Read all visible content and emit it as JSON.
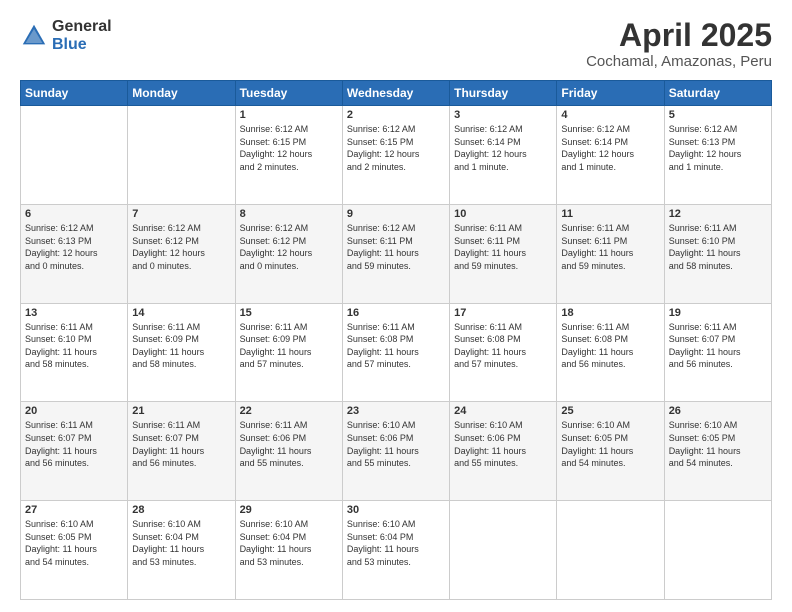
{
  "logo": {
    "general": "General",
    "blue": "Blue"
  },
  "header": {
    "title": "April 2025",
    "subtitle": "Cochamal, Amazonas, Peru"
  },
  "days_of_week": [
    "Sunday",
    "Monday",
    "Tuesday",
    "Wednesday",
    "Thursday",
    "Friday",
    "Saturday"
  ],
  "weeks": [
    [
      {
        "day": "",
        "info": ""
      },
      {
        "day": "",
        "info": ""
      },
      {
        "day": "1",
        "info": "Sunrise: 6:12 AM\nSunset: 6:15 PM\nDaylight: 12 hours\nand 2 minutes."
      },
      {
        "day": "2",
        "info": "Sunrise: 6:12 AM\nSunset: 6:15 PM\nDaylight: 12 hours\nand 2 minutes."
      },
      {
        "day": "3",
        "info": "Sunrise: 6:12 AM\nSunset: 6:14 PM\nDaylight: 12 hours\nand 1 minute."
      },
      {
        "day": "4",
        "info": "Sunrise: 6:12 AM\nSunset: 6:14 PM\nDaylight: 12 hours\nand 1 minute."
      },
      {
        "day": "5",
        "info": "Sunrise: 6:12 AM\nSunset: 6:13 PM\nDaylight: 12 hours\nand 1 minute."
      }
    ],
    [
      {
        "day": "6",
        "info": "Sunrise: 6:12 AM\nSunset: 6:13 PM\nDaylight: 12 hours\nand 0 minutes."
      },
      {
        "day": "7",
        "info": "Sunrise: 6:12 AM\nSunset: 6:12 PM\nDaylight: 12 hours\nand 0 minutes."
      },
      {
        "day": "8",
        "info": "Sunrise: 6:12 AM\nSunset: 6:12 PM\nDaylight: 12 hours\nand 0 minutes."
      },
      {
        "day": "9",
        "info": "Sunrise: 6:12 AM\nSunset: 6:11 PM\nDaylight: 11 hours\nand 59 minutes."
      },
      {
        "day": "10",
        "info": "Sunrise: 6:11 AM\nSunset: 6:11 PM\nDaylight: 11 hours\nand 59 minutes."
      },
      {
        "day": "11",
        "info": "Sunrise: 6:11 AM\nSunset: 6:11 PM\nDaylight: 11 hours\nand 59 minutes."
      },
      {
        "day": "12",
        "info": "Sunrise: 6:11 AM\nSunset: 6:10 PM\nDaylight: 11 hours\nand 58 minutes."
      }
    ],
    [
      {
        "day": "13",
        "info": "Sunrise: 6:11 AM\nSunset: 6:10 PM\nDaylight: 11 hours\nand 58 minutes."
      },
      {
        "day": "14",
        "info": "Sunrise: 6:11 AM\nSunset: 6:09 PM\nDaylight: 11 hours\nand 58 minutes."
      },
      {
        "day": "15",
        "info": "Sunrise: 6:11 AM\nSunset: 6:09 PM\nDaylight: 11 hours\nand 57 minutes."
      },
      {
        "day": "16",
        "info": "Sunrise: 6:11 AM\nSunset: 6:08 PM\nDaylight: 11 hours\nand 57 minutes."
      },
      {
        "day": "17",
        "info": "Sunrise: 6:11 AM\nSunset: 6:08 PM\nDaylight: 11 hours\nand 57 minutes."
      },
      {
        "day": "18",
        "info": "Sunrise: 6:11 AM\nSunset: 6:08 PM\nDaylight: 11 hours\nand 56 minutes."
      },
      {
        "day": "19",
        "info": "Sunrise: 6:11 AM\nSunset: 6:07 PM\nDaylight: 11 hours\nand 56 minutes."
      }
    ],
    [
      {
        "day": "20",
        "info": "Sunrise: 6:11 AM\nSunset: 6:07 PM\nDaylight: 11 hours\nand 56 minutes."
      },
      {
        "day": "21",
        "info": "Sunrise: 6:11 AM\nSunset: 6:07 PM\nDaylight: 11 hours\nand 56 minutes."
      },
      {
        "day": "22",
        "info": "Sunrise: 6:11 AM\nSunset: 6:06 PM\nDaylight: 11 hours\nand 55 minutes."
      },
      {
        "day": "23",
        "info": "Sunrise: 6:10 AM\nSunset: 6:06 PM\nDaylight: 11 hours\nand 55 minutes."
      },
      {
        "day": "24",
        "info": "Sunrise: 6:10 AM\nSunset: 6:06 PM\nDaylight: 11 hours\nand 55 minutes."
      },
      {
        "day": "25",
        "info": "Sunrise: 6:10 AM\nSunset: 6:05 PM\nDaylight: 11 hours\nand 54 minutes."
      },
      {
        "day": "26",
        "info": "Sunrise: 6:10 AM\nSunset: 6:05 PM\nDaylight: 11 hours\nand 54 minutes."
      }
    ],
    [
      {
        "day": "27",
        "info": "Sunrise: 6:10 AM\nSunset: 6:05 PM\nDaylight: 11 hours\nand 54 minutes."
      },
      {
        "day": "28",
        "info": "Sunrise: 6:10 AM\nSunset: 6:04 PM\nDaylight: 11 hours\nand 53 minutes."
      },
      {
        "day": "29",
        "info": "Sunrise: 6:10 AM\nSunset: 6:04 PM\nDaylight: 11 hours\nand 53 minutes."
      },
      {
        "day": "30",
        "info": "Sunrise: 6:10 AM\nSunset: 6:04 PM\nDaylight: 11 hours\nand 53 minutes."
      },
      {
        "day": "",
        "info": ""
      },
      {
        "day": "",
        "info": ""
      },
      {
        "day": "",
        "info": ""
      }
    ]
  ]
}
